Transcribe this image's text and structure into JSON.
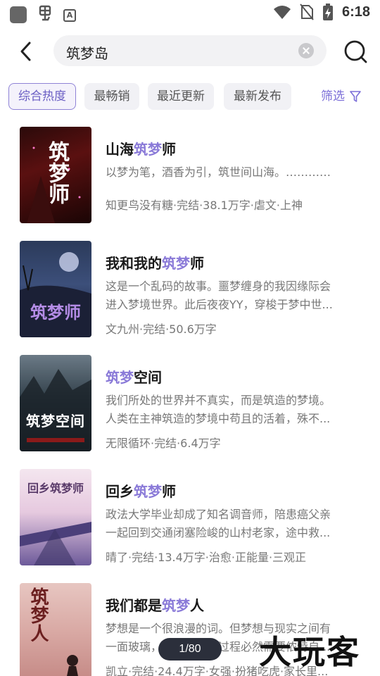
{
  "status_bar": {
    "time": "6:18",
    "icons": [
      "app-icon",
      "bug-icon",
      "a-icon",
      "wifi-icon",
      "no-sim-icon",
      "battery-charging-icon"
    ]
  },
  "search": {
    "query": "筑梦岛",
    "back_icon": "chevron-left-icon",
    "clear_icon": "clear-icon",
    "search_icon": "search-icon"
  },
  "chips": [
    {
      "label": "综合热度",
      "active": true
    },
    {
      "label": "最畅销",
      "active": false
    },
    {
      "label": "最近更新",
      "active": false
    },
    {
      "label": "最新发布",
      "active": false
    }
  ],
  "filter": {
    "label": "筛选",
    "icon": "funnel-icon"
  },
  "accent": "#8a7ad8",
  "books": [
    {
      "title_pre": "山海",
      "title_hl": "筑梦",
      "title_post": "师",
      "desc": [
        "以梦为笔，酒香为引，筑世间山海。…………"
      ],
      "meta": "知更鸟没有糖·完结·38.1万字·虐文·上神",
      "cover_text": "筑梦师"
    },
    {
      "title_pre": "我和我的",
      "title_hl": "筑梦",
      "title_post": "师",
      "desc": [
        "这是一个乱码的故事。噩梦缠身的我因缘际会",
        "进入梦境世界。此后夜夜YY，穿梭于梦中世..."
      ],
      "meta": "文九州·完结·50.6万字",
      "cover_text": "筑梦师"
    },
    {
      "title_pre": "",
      "title_hl": "筑梦",
      "title_post": "空间",
      "desc": [
        "我们所处的世界并不真实，而是筑造的梦境。",
        "人类在主神筑造的梦境中苟且的活着，殊不..."
      ],
      "meta": "无限循环·完结·6.4万字",
      "cover_text": "筑梦空间"
    },
    {
      "title_pre": "回乡",
      "title_hl": "筑梦",
      "title_post": "师",
      "desc": [
        "政法大学毕业却成了知名调音师，陪患癌父亲",
        "一起回到交通闭塞险峻的山村老家，途中救..."
      ],
      "meta": "晴了·完结·13.4万字·治愈·正能量·三观正",
      "cover_text": "回乡筑梦师"
    },
    {
      "title_pre": "我们都是",
      "title_hl": "筑梦",
      "title_post": "人",
      "desc": [
        "梦想是一个很浪漫的词。但梦想与现实之间有",
        "一面玻璃，打破这面的过程必然需要侬特自..."
      ],
      "meta": "凯立·完结·24.4万字·女强·扮猪吃虎·家长里...",
      "cover_text": "筑梦人"
    }
  ],
  "pager": "1/80",
  "watermark": "大玩客"
}
